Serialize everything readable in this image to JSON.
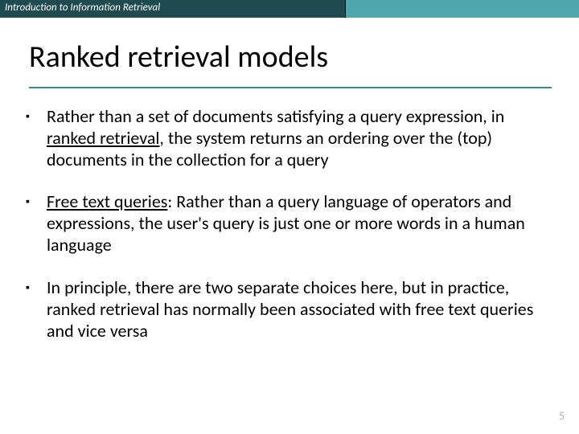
{
  "header": {
    "label": "Introduction to Information Retrieval"
  },
  "title": "Ranked retrieval models",
  "bullets": [
    {
      "pre": "Rather than a set of documents satisfying a query expression, in ",
      "u": "ranked retrieval",
      "post": ", the system returns an ordering over the (top) documents in the collection for a query"
    },
    {
      "pre": "",
      "u": "Free text queries",
      "post": ": Rather than a query language of operators and expressions, the user's query is just one or more words in a human language"
    },
    {
      "pre": "In principle, there are two separate choices here, but in practice, ranked retrieval has normally been associated with free text queries and vice versa",
      "u": "",
      "post": ""
    }
  ],
  "page_number": "5"
}
